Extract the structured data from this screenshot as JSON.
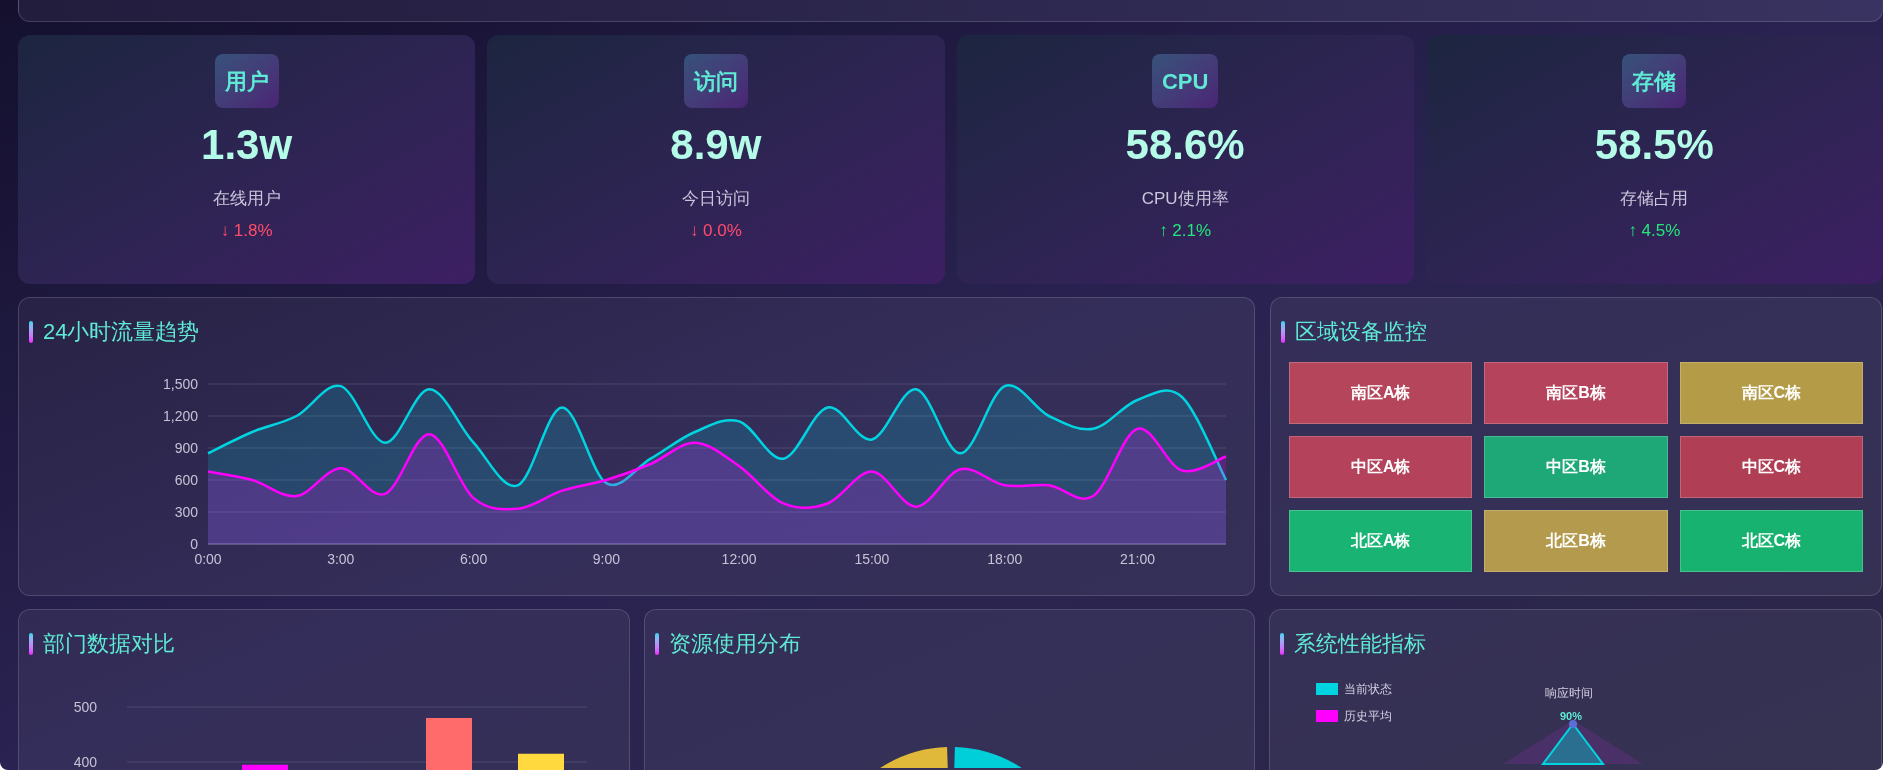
{
  "stats": [
    {
      "badge": "用户",
      "value": "1.3w",
      "label": "在线用户",
      "arrow": "↓",
      "change": "1.8%",
      "color": "#ff4d6a"
    },
    {
      "badge": "访问",
      "value": "8.9w",
      "label": "今日访问",
      "arrow": "↓",
      "change": "0.0%",
      "color": "#ff4d6a"
    },
    {
      "badge": "CPU",
      "value": "58.6%",
      "label": "CPU使用率",
      "arrow": "↑",
      "change": "2.1%",
      "color": "#22e87a"
    },
    {
      "badge": "存储",
      "value": "58.5%",
      "label": "存储占用",
      "arrow": "↑",
      "change": "4.5%",
      "color": "#22e87a"
    }
  ],
  "traffic": {
    "title": "24小时流量趋势",
    "chart_data": {
      "type": "area",
      "grid": true,
      "x": [
        0,
        1,
        2,
        3,
        4,
        5,
        6,
        7,
        8,
        9,
        10,
        11,
        12,
        13,
        14,
        15,
        16,
        17,
        18,
        19,
        20,
        21,
        22,
        23
      ],
      "xlim": [
        0,
        23
      ],
      "xticks": [
        {
          "value": 0,
          "label": "0:00"
        },
        {
          "value": 3,
          "label": "3:00"
        },
        {
          "value": 6,
          "label": "6:00"
        },
        {
          "value": 9,
          "label": "9:00"
        },
        {
          "value": 12,
          "label": "12:00"
        },
        {
          "value": 15,
          "label": "15:00"
        },
        {
          "value": 18,
          "label": "18:00"
        },
        {
          "value": 21,
          "label": "21:00"
        }
      ],
      "yticks": [
        {
          "value": 0,
          "label": "0"
        },
        {
          "value": 300,
          "label": "300"
        },
        {
          "value": 600,
          "label": "600"
        },
        {
          "value": 900,
          "label": "900"
        },
        {
          "value": 1200,
          "label": "1,200"
        },
        {
          "value": 1500,
          "label": "1,500"
        }
      ],
      "ylim": [
        0,
        1500
      ],
      "series": [
        {
          "color": "#00d4e0",
          "values": [
            850,
            1050,
            1200,
            1480,
            950,
            1450,
            950,
            550,
            1280,
            570,
            800,
            1050,
            1150,
            800,
            1280,
            980,
            1450,
            850,
            1480,
            1200,
            1080,
            1350,
            1380,
            600
          ]
        },
        {
          "color": "#ff00ff",
          "values": [
            680,
            600,
            450,
            710,
            470,
            1030,
            430,
            330,
            500,
            600,
            750,
            950,
            730,
            380,
            380,
            680,
            350,
            700,
            550,
            550,
            450,
            1080,
            690,
            820
          ]
        }
      ]
    }
  },
  "devices": {
    "title": "区域设备监控",
    "cells": [
      {
        "label": "南区A栋",
        "color": "#b5455a"
      },
      {
        "label": "南区B栋",
        "color": "#b5435c"
      },
      {
        "label": "南区C栋",
        "color": "#b39b48"
      },
      {
        "label": "中区A栋",
        "color": "#b3425a"
      },
      {
        "label": "中区B栋",
        "color": "#1ea878"
      },
      {
        "label": "中区C栋",
        "color": "#b03f55"
      },
      {
        "label": "北区A栋",
        "color": "#19b473"
      },
      {
        "label": "北区B栋",
        "color": "#b39a4c"
      },
      {
        "label": "北区C栋",
        "color": "#18b270"
      }
    ]
  },
  "departments": {
    "title": "部门数据对比",
    "chart_data": {
      "type": "bar",
      "grid": true,
      "values": [
        null,
        395,
        null,
        480,
        415
      ],
      "colors": [
        null,
        "#ff00ff",
        null,
        "#ff6b6b",
        "#ffd93d"
      ],
      "ylim": [
        0,
        500
      ],
      "yticks": [
        400,
        500
      ]
    }
  },
  "resources": {
    "title": "资源使用分布"
  },
  "performance": {
    "title": "系统性能指标",
    "legend": [
      {
        "label": "当前状态",
        "color": "#00d4e0"
      },
      {
        "label": "历史平均",
        "color": "#ff00ff"
      }
    ],
    "axis_label": "响应时间",
    "axis_value": "90%"
  }
}
